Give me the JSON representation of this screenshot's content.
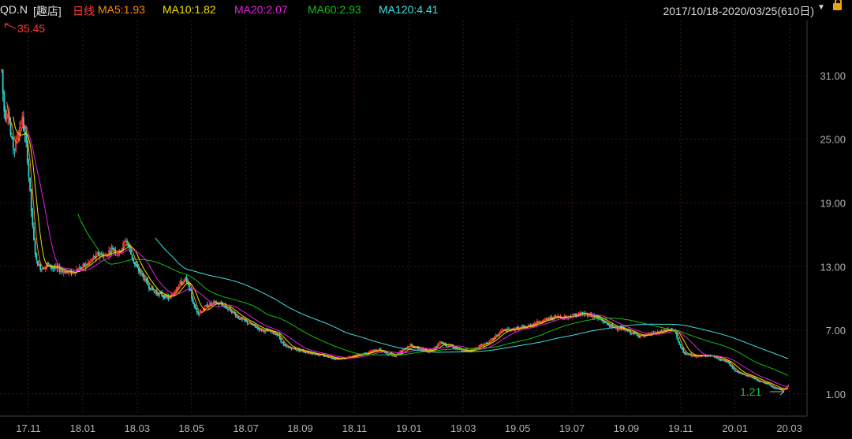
{
  "header": {
    "symbol": "QD.N",
    "name": "[趣店]",
    "period": "日线",
    "ma": [
      {
        "label": "MA5:1.93",
        "color": "#ff8a00"
      },
      {
        "label": "MA10:1.82",
        "color": "#f0e000"
      },
      {
        "label": "MA20:2.07",
        "color": "#e020e0"
      },
      {
        "label": "MA60:2.93",
        "color": "#10c010"
      },
      {
        "label": "MA120:4.41",
        "color": "#40e0e0"
      }
    ],
    "range": "2017/10/18-2020/03/25(610日)",
    "dropdown_icon": "chevron-down-icon",
    "lock_icon": "lock-icon"
  },
  "colors": {
    "up": "#ff3b3b",
    "down": "#30d0d0",
    "grid": "#3a1a1a",
    "axis": "#b0b0b0",
    "max_label": "#ff3b3b",
    "min_label": "#20c040"
  },
  "chart_data": {
    "type": "candlestick",
    "ylim": [
      -0.8,
      36.2
    ],
    "y_ticks": [
      "31.00",
      "25.00",
      "19.00",
      "13.00",
      "7.00",
      "1.00"
    ],
    "y_tick_values": [
      31,
      25,
      19,
      13,
      7,
      1
    ],
    "x_ticks": [
      "17.11",
      "18.01",
      "18.03",
      "18.05",
      "18.07",
      "18.09",
      "18.11",
      "19.01",
      "19.03",
      "19.05",
      "19.07",
      "19.09",
      "19.11",
      "20.01",
      "20.03"
    ],
    "max_label": "35.45",
    "min_label": "1.21",
    "max_value": 35.45,
    "min_value": 1.21,
    "price_path": [
      [
        0,
        34.5
      ],
      [
        3,
        30
      ],
      [
        6,
        27
      ],
      [
        10,
        28
      ],
      [
        14,
        25
      ],
      [
        18,
        24
      ],
      [
        24,
        26
      ],
      [
        28,
        27
      ],
      [
        34,
        24
      ],
      [
        38,
        20
      ],
      [
        42,
        16
      ],
      [
        46,
        13.5
      ],
      [
        52,
        12.8
      ],
      [
        60,
        13.2
      ],
      [
        70,
        12.8
      ],
      [
        80,
        12.6
      ],
      [
        90,
        12.4
      ],
      [
        100,
        12.8
      ],
      [
        110,
        13.2
      ],
      [
        118,
        13.8
      ],
      [
        126,
        14.2
      ],
      [
        134,
        14.0
      ],
      [
        142,
        14.8
      ],
      [
        150,
        14.2
      ],
      [
        160,
        15.6
      ],
      [
        166,
        14.2
      ],
      [
        172,
        13.0
      ],
      [
        180,
        12.2
      ],
      [
        188,
        11.2
      ],
      [
        196,
        10.6
      ],
      [
        205,
        10.3
      ],
      [
        215,
        10.0
      ],
      [
        225,
        11.2
      ],
      [
        235,
        11.8
      ],
      [
        240,
        11.0
      ],
      [
        246,
        9.2
      ],
      [
        252,
        8.6
      ],
      [
        262,
        9.3
      ],
      [
        272,
        9.6
      ],
      [
        282,
        9.4
      ],
      [
        292,
        8.9
      ],
      [
        302,
        8.2
      ],
      [
        312,
        7.8
      ],
      [
        322,
        7.4
      ],
      [
        332,
        7.0
      ],
      [
        342,
        6.9
      ],
      [
        352,
        6.6
      ],
      [
        360,
        5.5
      ],
      [
        370,
        5.3
      ],
      [
        380,
        5.1
      ],
      [
        392,
        4.9
      ],
      [
        404,
        4.7
      ],
      [
        416,
        4.5
      ],
      [
        428,
        4.3
      ],
      [
        440,
        4.4
      ],
      [
        450,
        4.6
      ],
      [
        460,
        4.8
      ],
      [
        470,
        5.0
      ],
      [
        480,
        5.2
      ],
      [
        490,
        4.8
      ],
      [
        500,
        4.6
      ],
      [
        510,
        5.2
      ],
      [
        520,
        5.6
      ],
      [
        532,
        5.2
      ],
      [
        542,
        5.0
      ],
      [
        552,
        5.4
      ],
      [
        558,
        6.0
      ],
      [
        565,
        5.6
      ],
      [
        572,
        5.5
      ],
      [
        580,
        5.2
      ],
      [
        590,
        5.0
      ],
      [
        600,
        5.2
      ],
      [
        610,
        5.6
      ],
      [
        620,
        5.9
      ],
      [
        628,
        6.4
      ],
      [
        636,
        7.0
      ],
      [
        646,
        7.0
      ],
      [
        656,
        7.2
      ],
      [
        666,
        7.3
      ],
      [
        676,
        7.6
      ],
      [
        686,
        7.9
      ],
      [
        696,
        8.1
      ],
      [
        706,
        8.3
      ],
      [
        716,
        8.2
      ],
      [
        726,
        8.4
      ],
      [
        736,
        8.6
      ],
      [
        746,
        8.5
      ],
      [
        756,
        8.2
      ],
      [
        766,
        7.8
      ],
      [
        776,
        7.3
      ],
      [
        786,
        7.2
      ],
      [
        796,
        6.9
      ],
      [
        806,
        6.6
      ],
      [
        816,
        6.4
      ],
      [
        826,
        6.7
      ],
      [
        836,
        6.8
      ],
      [
        846,
        7.1
      ],
      [
        856,
        6.9
      ],
      [
        862,
        5.4
      ],
      [
        868,
        4.8
      ],
      [
        878,
        4.6
      ],
      [
        890,
        4.6
      ],
      [
        902,
        4.6
      ],
      [
        912,
        4.3
      ],
      [
        922,
        4.0
      ],
      [
        932,
        3.2
      ],
      [
        942,
        2.8
      ],
      [
        952,
        2.6
      ],
      [
        962,
        2.2
      ],
      [
        972,
        2.0
      ],
      [
        980,
        1.6
      ],
      [
        990,
        1.4
      ],
      [
        996,
        1.5
      ],
      [
        1000,
        1.93
      ]
    ]
  }
}
